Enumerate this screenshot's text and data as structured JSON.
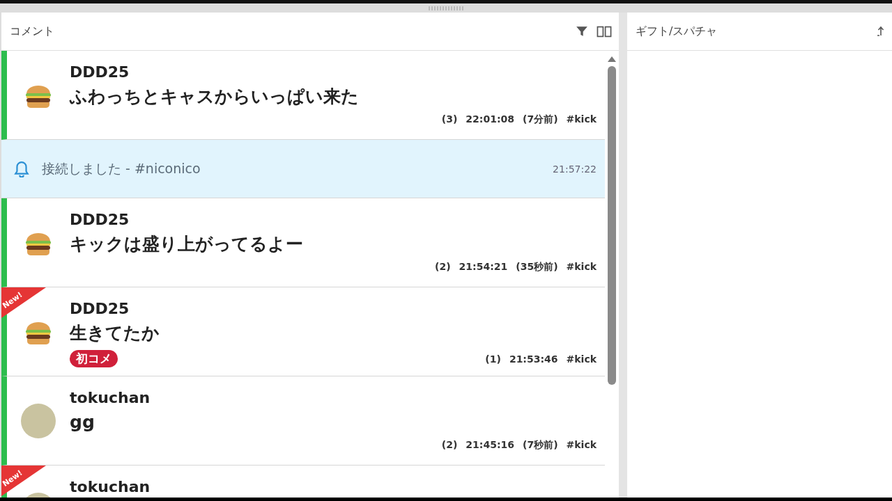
{
  "comments_panel": {
    "title": "コメント"
  },
  "gifts_panel": {
    "title": "ギフト/スパチャ"
  },
  "comments": [
    {
      "kind": "comment",
      "is_new": false,
      "avatar": {
        "kind": "burger"
      },
      "name": "DDD25",
      "message": "ふわっちとキャスからいっぱい来た",
      "meta": [
        "(3)",
        "22:01:08",
        "(7分前)",
        "#kick"
      ]
    },
    {
      "kind": "system",
      "message": "接続しました - #niconico",
      "time": "21:57:22"
    },
    {
      "kind": "comment",
      "is_new": false,
      "avatar": {
        "kind": "burger"
      },
      "name": "DDD25",
      "message": "キックは盛り上がってるよー",
      "meta": [
        "(2)",
        "21:54:21",
        "(35秒前)",
        "#kick"
      ]
    },
    {
      "kind": "comment",
      "is_new": true,
      "new_label": "New!",
      "avatar": {
        "kind": "burger"
      },
      "name": "DDD25",
      "message": "生きてたか",
      "badges": [
        "初コメ"
      ],
      "meta": [
        "(1)",
        "21:53:46",
        "#kick"
      ]
    },
    {
      "kind": "comment",
      "is_new": false,
      "avatar": {
        "kind": "photo"
      },
      "name": "tokuchan",
      "message": "gg",
      "meta": [
        "(2)",
        "21:45:16",
        "(7秒前)",
        "#kick"
      ]
    },
    {
      "kind": "comment",
      "is_new": true,
      "new_label": "New!",
      "avatar": {
        "kind": "photo"
      },
      "name": "tokuchan"
    }
  ]
}
